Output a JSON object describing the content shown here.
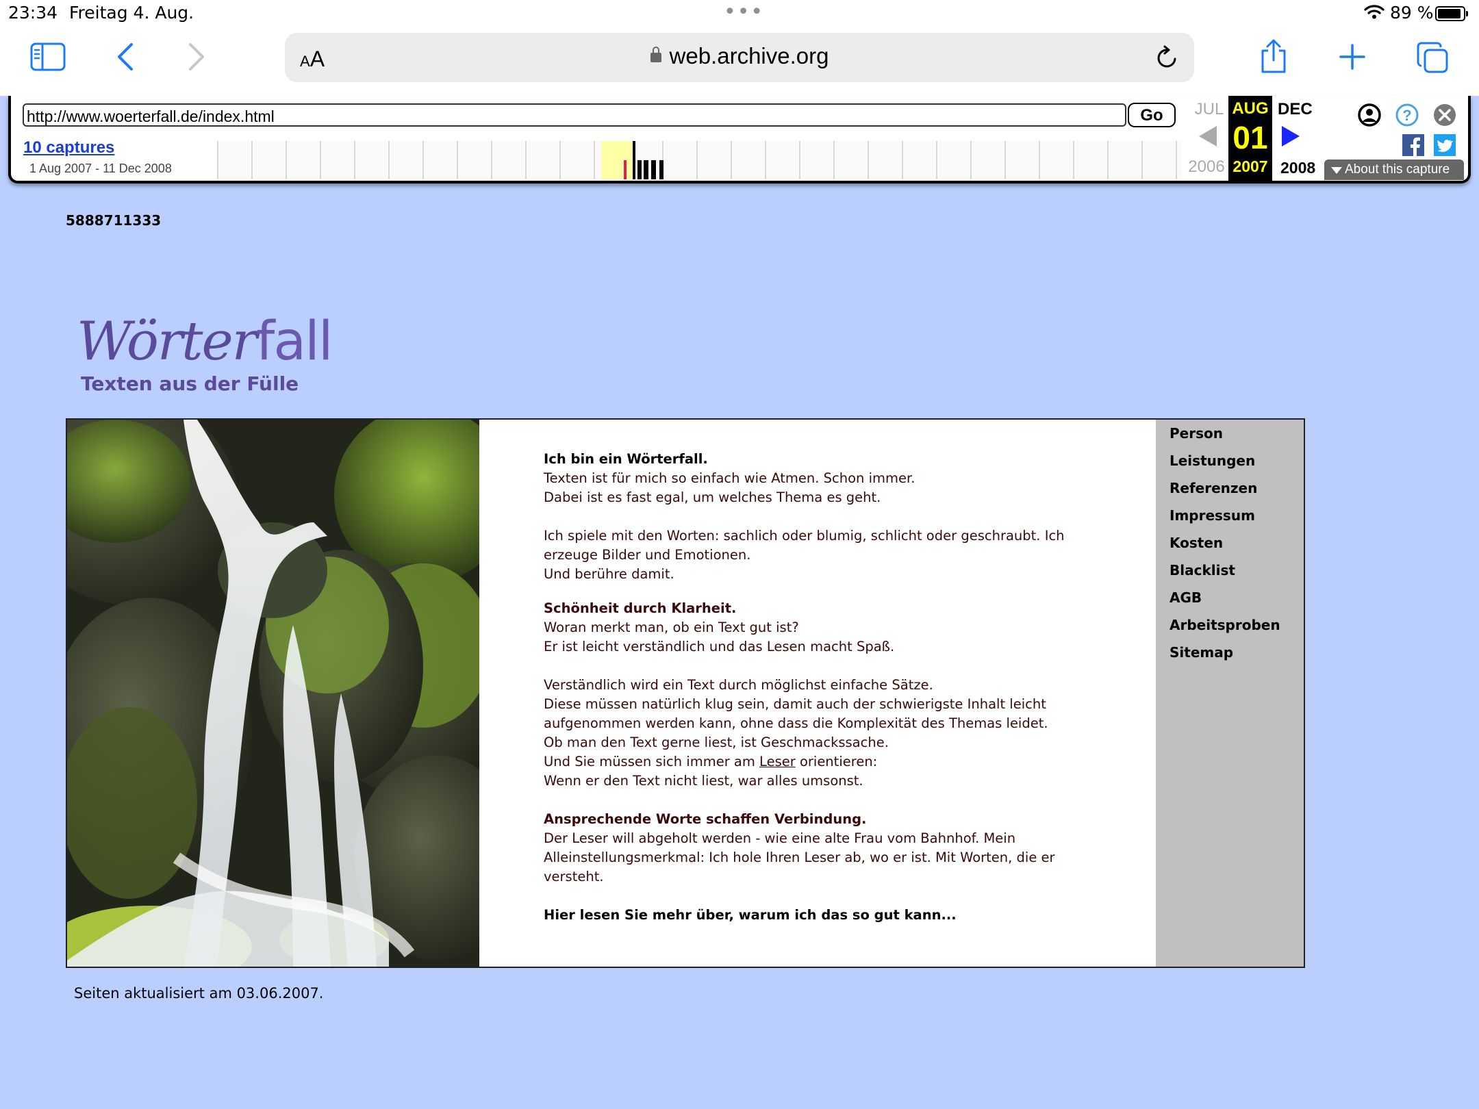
{
  "status_bar": {
    "time": "23:34",
    "date": "Freitag 4. Aug.",
    "battery": "89 %"
  },
  "browser": {
    "text_size_label": "AA",
    "host": "web.archive.org"
  },
  "wayback": {
    "url_value": "http://www.woerterfall.de/index.html",
    "go_label": "Go",
    "captures_label": "10 captures",
    "range_label": "1 Aug 2007 - 11 Dec 2008",
    "prev_month": "JUL",
    "prev_year": "2006",
    "cur_month": "AUG",
    "cur_day": "01",
    "cur_year": "2007",
    "next_month": "DEC",
    "next_year": "2008",
    "about_label": "About this capture"
  },
  "page": {
    "counter": "5888711333",
    "logo_word_a": "Wörter",
    "logo_word_b": "fall",
    "logo_tagline": "Texten aus der Fülle",
    "heading1": "Ich bin ein Wörterfall.",
    "p1_l1": "Texten ist für mich so einfach wie Atmen. Schon immer.",
    "p1_l2": "Dabei ist es fast egal, um welches Thema es geht.",
    "p2_l1": "Ich spiele mit den Worten: sachlich oder blumig, schlicht oder geschraubt. Ich",
    "p2_l2": "erzeuge Bilder und Emotionen.",
    "p2_l3": "Und berühre damit.",
    "heading2": "Schönheit durch Klarheit.",
    "p3_l1": "Woran merkt man, ob ein Text gut ist?",
    "p3_l2": "Er ist leicht verständlich und das Lesen macht Spaß.",
    "p4_l1": "Verständlich wird ein Text durch möglichst einfache Sätze.",
    "p4_l2": "Diese müssen natürlich klug sein, damit auch der schwierigste Inhalt leicht",
    "p4_l3": "aufgenommen werden kann, ohne dass die Komplexität des Themas leidet.",
    "p4_l4": "Ob man den Text gerne liest, ist Geschmackssache.",
    "p4_l5_a": "Und Sie müssen sich immer am ",
    "p4_l5_link": "Leser",
    "p4_l5_b": " orientieren:",
    "p4_l6": "Wenn er den Text nicht liest, war alles umsonst.",
    "heading3": "Ansprechende Worte schaffen Verbindung.",
    "p5_l1": "Der Leser will abgeholt werden - wie eine alte Frau vom Bahnhof. Mein",
    "p5_l2": "Alleinstellungsmerkmal: Ich hole Ihren Leser ab, wo er ist. Mit Worten, die er",
    "p5_l3": "versteht.",
    "more_link": "Hier lesen Sie mehr über, warum ich das so gut kann...",
    "nav": [
      "Person",
      "Leistungen",
      "Referenzen",
      "Impressum",
      "Kosten",
      "Blacklist",
      "AGB",
      "Arbeitsproben",
      "Sitemap"
    ],
    "footer": "Seiten aktualisiert am 03.06.2007."
  },
  "colors": {
    "page_bg": "#bbcfff",
    "nav_bg": "#c0c0c0",
    "logo": "#5a4a9a",
    "wayback_year": "#ffff00",
    "ios_blue": "#1a7cf5"
  }
}
